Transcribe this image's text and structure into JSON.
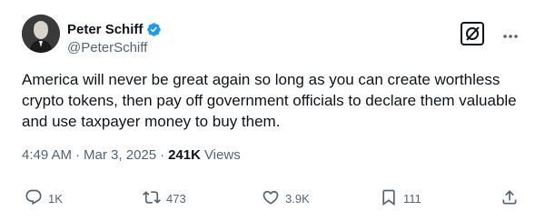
{
  "user": {
    "display_name": "Peter Schiff",
    "handle": "@PeterSchiff"
  },
  "tweet": {
    "text": "America will never be great again so long as you can create worthless crypto tokens, then pay off government officials to declare them valuable and use taxpayer money to buy them.",
    "time": "4:49 AM",
    "date": "Mar 3, 2025",
    "separator": "·",
    "views_count": "241K",
    "views_label": "Views"
  },
  "actions": {
    "replies": "1K",
    "reposts": "473",
    "likes": "3.9K",
    "bookmarks": "111"
  },
  "colors": {
    "text": "#0f1419",
    "secondary": "#536471",
    "verified": "#1d9bf0"
  },
  "icons": [
    "verified-badge-icon",
    "grok-icon",
    "more-icon",
    "reply-icon",
    "repost-icon",
    "like-icon",
    "bookmark-icon",
    "share-icon"
  ]
}
